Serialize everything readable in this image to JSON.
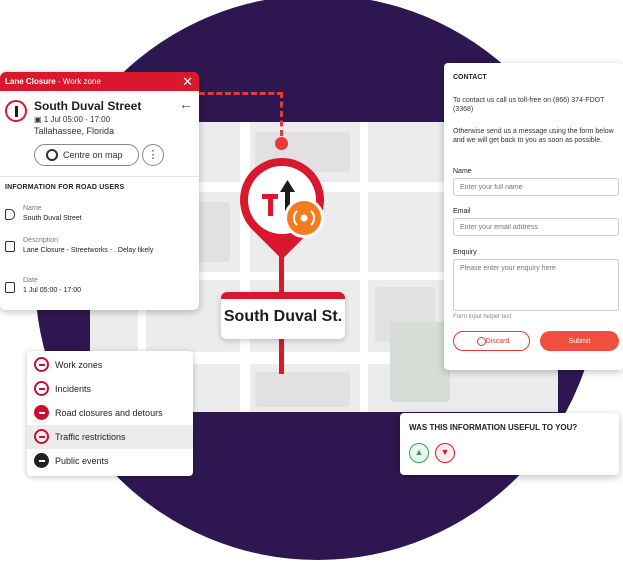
{
  "lane_closure_panel": {
    "header_type": "Lane Closure",
    "header_sub": " - Work zone",
    "close_icon": "close-icon",
    "street": "South Duval Street",
    "time": "1 Jul 05:00 - 17:00",
    "city": "Tallahassee, Florida",
    "centre_button": "Centre on map",
    "more_button": "more-options-icon",
    "info_title": "INFORMATION FOR ROAD USERS",
    "fields": [
      {
        "label": "Name",
        "value": "South Duval Street"
      },
      {
        "label": "Description",
        "value": "Lane Closure - Streetworks - . Delay likely"
      },
      {
        "label": "Date",
        "value": "1 Jul 05:00 - 17:00"
      }
    ]
  },
  "map": {
    "street_label": "South Duval St."
  },
  "legend": {
    "items": [
      {
        "label": "Work zones",
        "icon": "work-zone-icon"
      },
      {
        "label": "Incidents",
        "icon": "incident-icon"
      },
      {
        "label": "Road closures and detours",
        "icon": "road-closure-icon"
      },
      {
        "label": "Traffic restrictions",
        "icon": "traffic-restriction-icon",
        "active": true
      },
      {
        "label": "Public events",
        "icon": "public-event-icon"
      }
    ]
  },
  "contact": {
    "title": "CONTACT",
    "intro": "To contact us call us toll-free on (866) 374-FDOT (3368)",
    "otherwise": "Otherwise send us a message using the form below and we will get back to you as soon as possible.",
    "name_label": "Name",
    "name_placeholder": "Enter your full name",
    "email_label": "Email",
    "email_placeholder": "Enter your email address",
    "enquiry_label": "Enquiry",
    "enquiry_placeholder": "Please enter your enquiry here",
    "helper": "Form input helper text",
    "discard": "Discard",
    "submit": "Submit"
  },
  "feedback": {
    "title": "WAS THIS INFORMATION USEFUL TO YOU?"
  },
  "colors": {
    "accent_red": "#d9182d",
    "badge_orange": "#f47c20",
    "background_purple": "#2e1750",
    "positive_green": "#2fa45a"
  }
}
